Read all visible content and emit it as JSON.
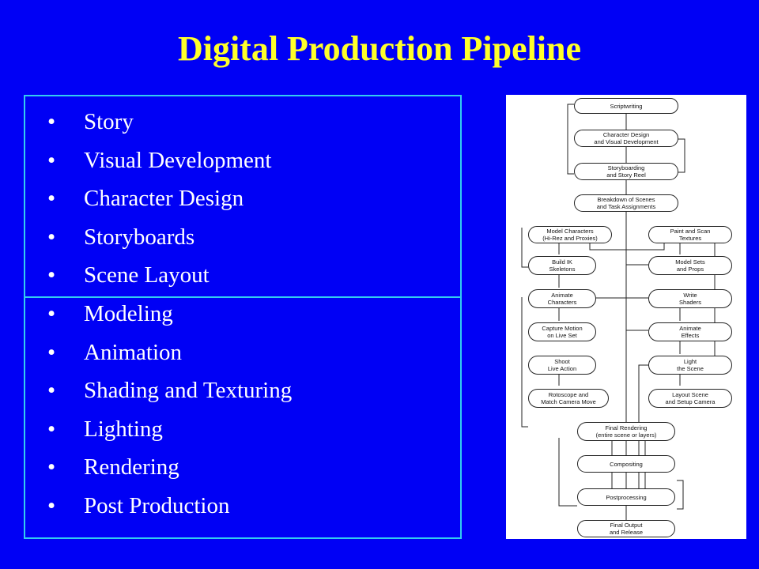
{
  "title": "Digital Production Pipeline",
  "colors": {
    "background": "#0000f5",
    "title": "#ffff2a",
    "box_border": "#33ccf0",
    "text": "#ffffff"
  },
  "bullet_glyph": "•",
  "pre_production": [
    "Story",
    "Visual Development",
    "Character Design",
    "Storyboards",
    "Scene Layout"
  ],
  "production": [
    "Modeling",
    "Animation",
    "Shading and Texturing",
    "Lighting",
    "Rendering",
    "Post Production"
  ],
  "flowchart": {
    "nodes": [
      "Scriptwriting",
      "Character Design\nand Visual Development",
      "Storyboarding\nand Story Reel",
      "Breakdown of Scenes\nand Task Assignments",
      "Model Characters\n(Hi-Rez and Proxies)",
      "Paint and Scan\nTextures",
      "Build IK\nSkeletons",
      "Model Sets\nand Props",
      "Animate\nCharacters",
      "Write\nShaders",
      "Capture Motion\non Live Set",
      "Animate\nEffects",
      "Shoot\nLive Action",
      "Light\nthe Scene",
      "Rotoscope and\nMatch Camera Move",
      "Layout Scene\nand Setup Camera",
      "Final Rendering\n(entire scene or layers)",
      "Compositing",
      "Postprocessing",
      "Final Output\nand Release"
    ]
  }
}
